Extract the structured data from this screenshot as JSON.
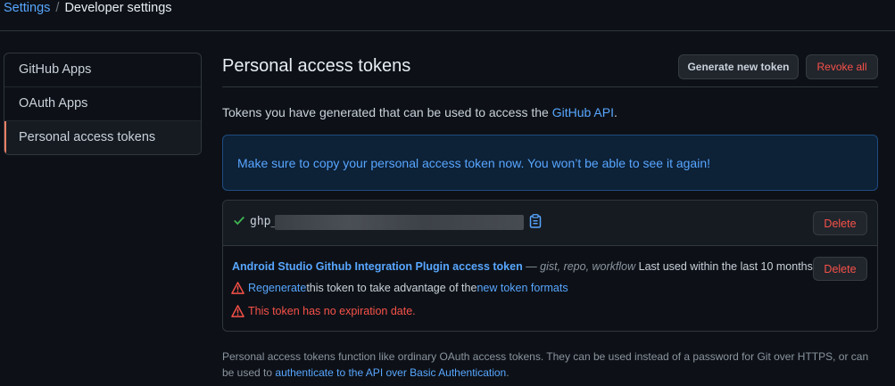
{
  "breadcrumb": {
    "root": "Settings",
    "separator": "/",
    "current": "Developer settings"
  },
  "sidebar": {
    "items": [
      {
        "label": "GitHub Apps"
      },
      {
        "label": "OAuth Apps"
      },
      {
        "label": "Personal access tokens"
      }
    ]
  },
  "header": {
    "title": "Personal access tokens",
    "generate_label": "Generate new token",
    "revoke_label": "Revoke all"
  },
  "intro": {
    "text": "Tokens you have generated that can be used to access the ",
    "link": "GitHub API",
    "suffix": "."
  },
  "flash": {
    "message": "Make sure to copy your personal access token now. You won’t be able to see it again!"
  },
  "new_token": {
    "prefix": "ghp_",
    "delete_label": "Delete"
  },
  "token": {
    "name": "Android Studio Github Integration Plugin access token",
    "dash": " — ",
    "scopes": "gist, repo, workflow",
    "last_used": " Last used within the last 10 months",
    "delete_label": "Delete",
    "regenerate_link": "Regenerate",
    "regenerate_text": " this token to take advantage of the ",
    "formats_link": "new token formats",
    "expiry_warning": "This token has no expiration date."
  },
  "footnote": {
    "text": "Personal access tokens function like ordinary OAuth access tokens. They can be used instead of a password for Git over HTTPS, or can be used to ",
    "link": "authenticate to the API over Basic Authentication",
    "suffix": "."
  },
  "colors": {
    "accent": "#58a6ff",
    "danger": "#f85149",
    "success": "#3fb950",
    "active_marker": "#f78166"
  }
}
